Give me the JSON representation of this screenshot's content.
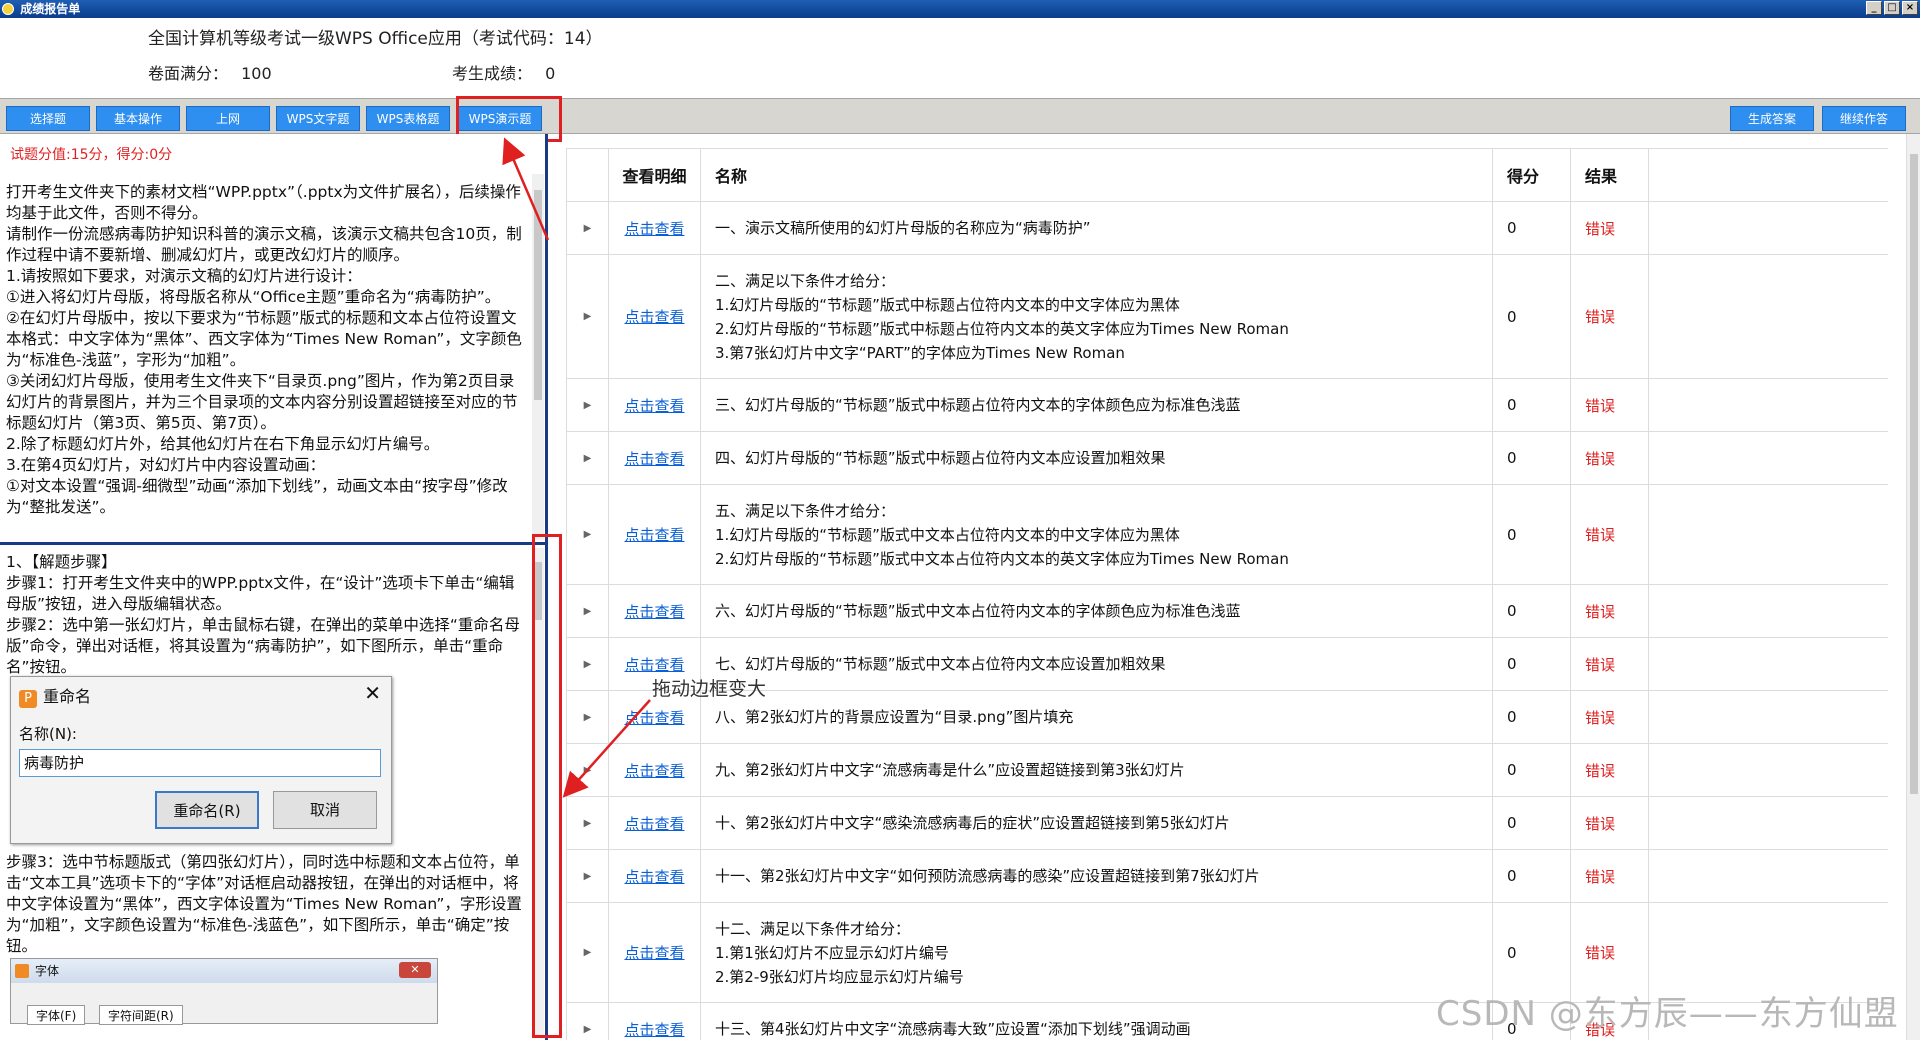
{
  "window": {
    "title": "成绩报告单",
    "controls": [
      "_",
      "□",
      "×"
    ]
  },
  "header": {
    "exam_title": "全国计算机等级考试一级WPS Office应用（考试代码：14）",
    "full_score_label": "卷面满分：",
    "full_score": "100",
    "student_score_label": "考生成绩：",
    "student_score": "0"
  },
  "toolbar": {
    "tabs": [
      "选择题",
      "基本操作",
      "上网",
      "WPS文字题",
      "WPS表格题",
      "WPS演示题"
    ],
    "generate_answer": "生成答案",
    "continue_exam": "继续作答"
  },
  "left": {
    "score_info": "试题分值:15分，得分:0分",
    "question": [
      "打开考生文件夹下的素材文档“WPP.pptx”（.pptx为文件扩展名），后续操作均基于此文件，否则不得分。",
      "请制作一份流感病毒防护知识科普的演示文稿，该演示文稿共包含10页，制作过程中请不要新增、删减幻灯片，或更改幻灯片的顺序。",
      "1.请按照如下要求，对演示文稿的幻灯片进行设计：",
      "①进入将幻灯片母版，将母版名称从“Office主题”重命名为“病毒防护”。",
      "②在幻灯片母版中，按以下要求为“节标题”版式的标题和文本占位符设置文本格式：中文字体为“黑体”、西文字体为“Times New Roman”，文字颜色为“标准色-浅蓝”，字形为“加粗”。",
      "③关闭幻灯片母版，使用考生文件夹下“目录页.png”图片，作为第2页目录幻灯片的背景图片，并为三个目录项的文本内容分别设置超链接至对应的节标题幻灯片（第3页、第5页、第7页）。",
      "2.除了标题幻灯片外，给其他幻灯片在右下角显示幻灯片编号。",
      "3.在第4页幻灯片，对幻灯片中内容设置动画：",
      "①对文本设置“强调-细微型”动画“添加下划线”，动画文本由“按字母”修改为“整批发送”。"
    ],
    "solution_part1": [
      "1、【解题步骤】",
      "步骤1：打开考生文件夹中的WPP.pptx文件，在“设计”选项卡下单击“编辑母版”按钮，进入母版编辑状态。",
      "步骤2：选中第一张幻灯片，单击鼠标右键，在弹出的菜单中选择“重命名母版”命令，弹出对话框，将其设置为“病毒防护”，如下图所示，单击“重命名”按钮。"
    ],
    "rename_dialog": {
      "title": "重命名",
      "close": "✕",
      "name_label": "名称(N):",
      "name_value": "病毒防护",
      "ok": "重命名(R)",
      "cancel": "取消"
    },
    "solution_part2": [
      "步骤3：选中节标题版式（第四张幻灯片），同时选中标题和文本占位符，单击“文本工具”选项卡下的“字体”对话框启动器按钮，在弹出的对话框中，将中文字体设置为“黑体”，西文字体设置为“Times New Roman”，字形设置为“加粗”，文字颜色设置为“标准色-浅蓝色”，如下图所示，单击“确定”按钮。"
    ],
    "font_dialog": {
      "title": "字体",
      "close": "✕",
      "tabs": [
        "字体(F)",
        "字符间距(R)"
      ]
    }
  },
  "annotation": "拖动边框变大",
  "table": {
    "headers": [
      "查看明细",
      "名称",
      "得分",
      "结果"
    ],
    "rows": [
      {
        "link": "点击查看",
        "name": [
          "一、演示文稿所使用的幻灯片母版的名称应为“病毒防护”"
        ],
        "score": "0",
        "result": "错误"
      },
      {
        "link": "点击查看",
        "name": [
          "二、满足以下条件才给分：",
          "1.幻灯片母版的“节标题”版式中标题占位符内文本的中文字体应为黑体",
          "2.幻灯片母版的“节标题”版式中标题占位符内文本的英文字体应为Times New Roman",
          "3.第7张幻灯片中文字“PART”的字体应为Times New Roman"
        ],
        "score": "0",
        "result": "错误"
      },
      {
        "link": "点击查看",
        "name": [
          "三、幻灯片母版的“节标题”版式中标题占位符内文本的字体颜色应为标准色浅蓝"
        ],
        "score": "0",
        "result": "错误"
      },
      {
        "link": "点击查看",
        "name": [
          "四、幻灯片母版的“节标题”版式中标题占位符内文本应设置加粗效果"
        ],
        "score": "0",
        "result": "错误"
      },
      {
        "link": "点击查看",
        "name": [
          "五、满足以下条件才给分：",
          "1.幻灯片母版的“节标题”版式中文本占位符内文本的中文字体应为黑体",
          "2.幻灯片母版的“节标题”版式中文本占位符内文本的英文字体应为Times New Roman"
        ],
        "score": "0",
        "result": "错误"
      },
      {
        "link": "点击查看",
        "name": [
          "六、幻灯片母版的“节标题”版式中文本占位符内文本的字体颜色应为标准色浅蓝"
        ],
        "score": "0",
        "result": "错误"
      },
      {
        "link": "点击查看",
        "name": [
          "七、幻灯片母版的“节标题”版式中文本占位符内文本应设置加粗效果"
        ],
        "score": "0",
        "result": "错误"
      },
      {
        "link": "点击查看",
        "name": [
          "八、第2张幻灯片的背景应设置为“目录.png”图片填充"
        ],
        "score": "0",
        "result": "错误"
      },
      {
        "link": "点击查看",
        "name": [
          "九、第2张幻灯片中文字“流感病毒是什么”应设置超链接到第3张幻灯片"
        ],
        "score": "0",
        "result": "错误"
      },
      {
        "link": "点击查看",
        "name": [
          "十、第2张幻灯片中文字“感染流感病毒后的症状”应设置超链接到第5张幻灯片"
        ],
        "score": "0",
        "result": "错误"
      },
      {
        "link": "点击查看",
        "name": [
          "十一、第2张幻灯片中文字“如何预防流感病毒的感染”应设置超链接到第7张幻灯片"
        ],
        "score": "0",
        "result": "错误"
      },
      {
        "link": "点击查看",
        "name": [
          "十二、满足以下条件才给分：",
          "1.第1张幻灯片不应显示幻灯片编号",
          "2.第2-9张幻灯片均应显示幻灯片编号"
        ],
        "score": "0",
        "result": "错误"
      },
      {
        "link": "点击查看",
        "name": [
          "十三、第4张幻灯片中文字“流感病毒大致”应设置“添加下划线”强调动画"
        ],
        "score": "0",
        "result": "错误"
      }
    ]
  },
  "watermark": "CSDN @东方辰——东方仙盟",
  "colors": {
    "accent_blue": "#2e8ff0",
    "error_red": "#e02020",
    "link_blue": "#0b5fd6",
    "annotation_red": "#e02020",
    "divider_navy": "#1a3a86"
  }
}
